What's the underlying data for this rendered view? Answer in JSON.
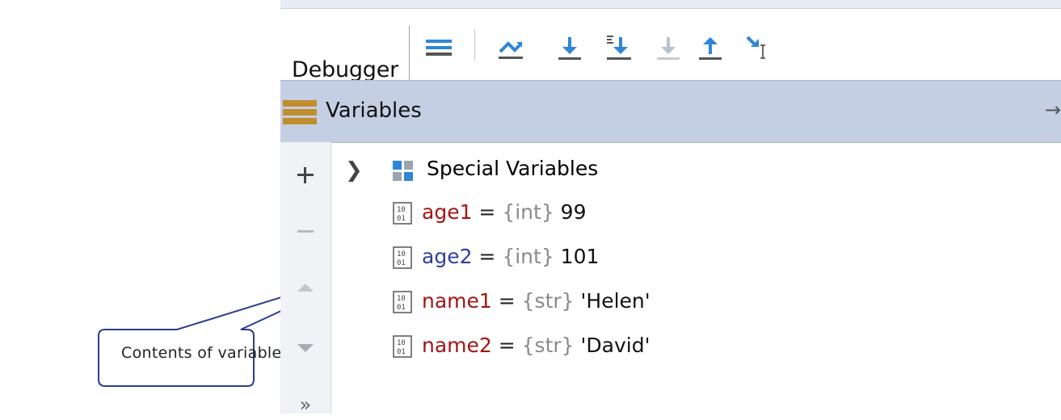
{
  "toolbar": {
    "tab_label": "Debugger",
    "buttons": [
      {
        "icon": "menu-lines-icon"
      },
      {
        "icon": "step-over-icon"
      },
      {
        "icon": "step-into-icon"
      },
      {
        "icon": "step-into-my-code-icon"
      },
      {
        "icon": "force-step-into-icon"
      },
      {
        "icon": "step-out-icon"
      },
      {
        "icon": "run-to-cursor-icon"
      }
    ]
  },
  "variables_panel": {
    "title": "Variables",
    "pin_glyph": "→",
    "tree_root": {
      "label": "Special Variables",
      "expanded": false
    },
    "rows": [
      {
        "name": "age1",
        "eq": " = ",
        "type": "{int}",
        "value": " 99",
        "name_color": "#a31515"
      },
      {
        "name": "age2",
        "eq": " = ",
        "type": "{int}",
        "value": " 101",
        "name_color": "#2e3ea0"
      },
      {
        "name": "name1",
        "eq": " = ",
        "type": "{str}",
        "value": " 'Helen'",
        "name_color": "#a31515"
      },
      {
        "name": "name2",
        "eq": " = ",
        "type": "{str}",
        "value": " 'David'",
        "name_color": "#a31515"
      }
    ]
  },
  "sidebar": {
    "buttons": [
      "add-icon",
      "remove-icon",
      "move-up-icon",
      "move-down-icon",
      "more-icon"
    ],
    "more_glyph": "»"
  },
  "callout": {
    "text": "Contents of variables"
  },
  "colors": {
    "accent_blue": "#2f86d6",
    "header_bg": "#c5cfe3",
    "var_name_red": "#a31515",
    "var_name_blue": "#2e3ea0"
  }
}
